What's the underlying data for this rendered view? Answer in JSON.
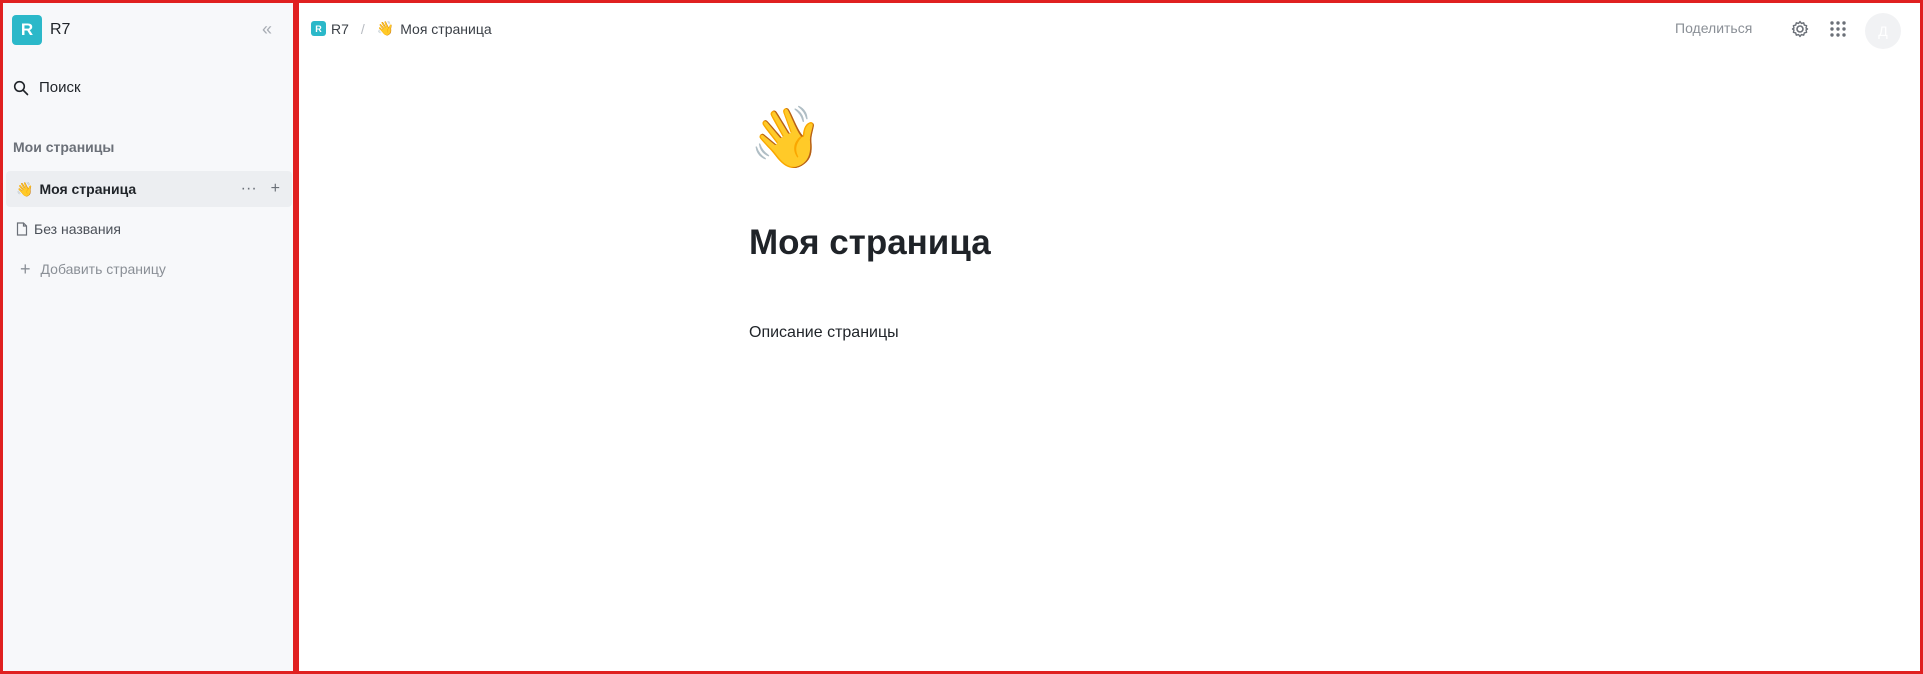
{
  "workspace": {
    "logo_letter": "R",
    "name": "R7",
    "collapse_icon": "«"
  },
  "sidebar": {
    "search_label": "Поиск",
    "section_title": "Мои страницы",
    "items": [
      {
        "emoji": "👋",
        "label": "Моя страница",
        "active": true
      },
      {
        "label": "Без названия"
      }
    ],
    "add_page_label": "Добавить страницу",
    "more_icon": "···",
    "add_child_icon": "+"
  },
  "breadcrumb": {
    "logo_letter": "R",
    "root": "R7",
    "separator": "/",
    "page_emoji": "👋",
    "page": "Моя страница"
  },
  "topbar": {
    "share_label": "Поделиться",
    "avatar_letter": "Д"
  },
  "page": {
    "emoji": "👋",
    "title": "Моя страница",
    "description": "Описание страницы"
  },
  "colors": {
    "accent": "#2bb8c9",
    "highlight_border": "#e02020",
    "sidebar_bg": "#f7f8fa"
  }
}
